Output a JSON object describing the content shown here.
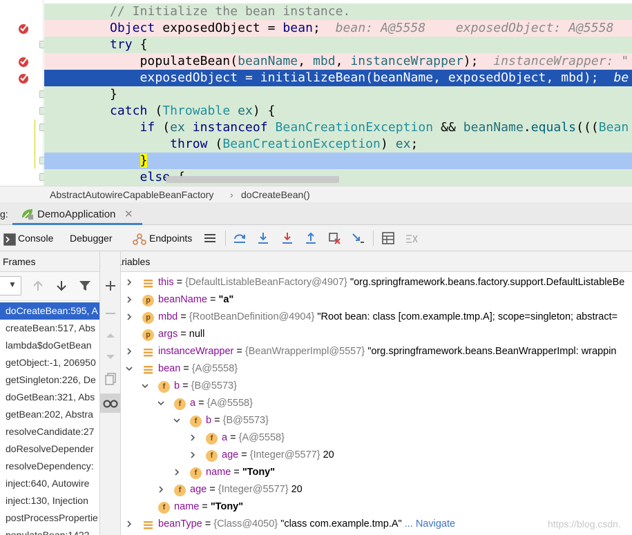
{
  "editor": {
    "lines": [
      {
        "segments": [
          {
            "t": "// Initialize the bean instance.",
            "c": "cmt"
          }
        ],
        "bg": "#d7ead6",
        "breakpoint": false,
        "fold": false
      },
      {
        "segments": [
          {
            "t": "Object ",
            "c": "kw"
          },
          {
            "t": "exposedObject = ",
            "c": "plain"
          },
          {
            "t": "bean",
            "c": "kwb"
          },
          {
            "t": ";  ",
            "c": "plain"
          },
          {
            "t": "bean: A@5558    exposedObject: A@5558",
            "c": "hint"
          }
        ],
        "bg": "#fbe3e3",
        "breakpoint": true,
        "fold": false
      },
      {
        "segments": [
          {
            "t": "try ",
            "c": "kw"
          },
          {
            "t": "{",
            "c": "plain"
          }
        ],
        "bg": "#d7ead6",
        "breakpoint": false,
        "fold": true
      },
      {
        "segments": [
          {
            "t": "    populateBean(",
            "c": "plain"
          },
          {
            "t": "beanName",
            "c": "param"
          },
          {
            "t": ", ",
            "c": "plain"
          },
          {
            "t": "mbd",
            "c": "param"
          },
          {
            "t": ", ",
            "c": "plain"
          },
          {
            "t": "instanceWrapper",
            "c": "param"
          },
          {
            "t": ");  ",
            "c": "plain"
          },
          {
            "t": "instanceWrapper: \"",
            "c": "hint"
          }
        ],
        "bg": "#fbe3e3",
        "breakpoint": true,
        "fold": false
      },
      {
        "segments": [
          {
            "t": "    exposedObject = initializeBean(beanName, exposedObject, mbd);  ",
            "c": "plain"
          },
          {
            "t": "be",
            "c": "hint"
          }
        ],
        "bg": "#2155b3",
        "breakpoint": true,
        "fold": false,
        "selected": true
      },
      {
        "segments": [
          {
            "t": "}",
            "c": "plain"
          }
        ],
        "bg": "#d7ead6",
        "breakpoint": false,
        "fold": true
      },
      {
        "segments": [
          {
            "t": "catch ",
            "c": "kw"
          },
          {
            "t": "(",
            "c": "plain"
          },
          {
            "t": "Throwable ",
            "c": "cls"
          },
          {
            "t": "ex",
            "c": "param"
          },
          {
            "t": ") {",
            "c": "plain"
          }
        ],
        "bg": "#d7ead6",
        "breakpoint": false,
        "fold": true
      },
      {
        "segments": [
          {
            "t": "    if ",
            "c": "kw"
          },
          {
            "t": "(",
            "c": "plain"
          },
          {
            "t": "ex ",
            "c": "param"
          },
          {
            "t": "instanceof ",
            "c": "kw"
          },
          {
            "t": "BeanCreationException ",
            "c": "cls"
          },
          {
            "t": "&& ",
            "c": "plain"
          },
          {
            "t": "beanName",
            "c": "param"
          },
          {
            "t": ".",
            "c": "plain"
          },
          {
            "t": "equals",
            "c": "meth"
          },
          {
            "t": "(((",
            "c": "plain"
          },
          {
            "t": "Bean",
            "c": "cls"
          }
        ],
        "bg": "#d7ead6",
        "breakpoint": false,
        "fold": true
      },
      {
        "segments": [
          {
            "t": "        throw ",
            "c": "kw"
          },
          {
            "t": "(",
            "c": "plain"
          },
          {
            "t": "BeanCreationException",
            "c": "cls"
          },
          {
            "t": ") ",
            "c": "plain"
          },
          {
            "t": "ex",
            "c": "param"
          },
          {
            "t": ";",
            "c": "plain"
          }
        ],
        "bg": "#d7ead6",
        "breakpoint": false,
        "fold": false
      },
      {
        "segments": [
          {
            "t": "    }",
            "c": "brace"
          }
        ],
        "bg": "#a8c6f4",
        "breakpoint": false,
        "fold": true
      },
      {
        "segments": [
          {
            "t": "    else ",
            "c": "kw"
          },
          {
            "t": "{",
            "c": "plain"
          }
        ],
        "bg": "#d7ead6",
        "breakpoint": false,
        "fold": true
      }
    ]
  },
  "breadcrumb": {
    "class_name": "AbstractAutowireCapableBeanFactory",
    "separator": "›",
    "method": "doCreateBean()"
  },
  "debug": {
    "title_label": "g:",
    "run_tab": "DemoApplication",
    "tabs": {
      "console": "Console",
      "debugger": "Debugger",
      "endpoints": "Endpoints"
    }
  },
  "frames": {
    "header": "Frames",
    "items": [
      "doCreateBean:595, A",
      "createBean:517, Abs",
      "lambda$doGetBean",
      "getObject:-1, 206950",
      "getSingleton:226, De",
      "doGetBean:321, Abs",
      "getBean:202, Abstra",
      "resolveCandidate:27",
      "doResolveDepender",
      "resolveDependency:",
      "inject:640, Autowire",
      "inject:130, Injection",
      "postProcessPropertie",
      "populateBean:1422"
    ],
    "selected_index": 0
  },
  "variables": {
    "header": "Variables",
    "rows": [
      {
        "depth": 0,
        "arrow": "right",
        "icon": "list",
        "name": "this",
        "eq": " = ",
        "ref": "{DefaultListableBeanFactory@4907} ",
        "value": "\"org.springframework.beans.factory.support.DefaultListableBe",
        "value_bold": false,
        "nav": ""
      },
      {
        "depth": 0,
        "arrow": "right",
        "icon": "p",
        "name": "beanName",
        "eq": " = ",
        "ref": "",
        "value": "\"a\"",
        "value_bold": true,
        "nav": ""
      },
      {
        "depth": 0,
        "arrow": "right",
        "icon": "p",
        "name": "mbd",
        "eq": " = ",
        "ref": "{RootBeanDefinition@4904} ",
        "value": "\"Root bean: class [com.example.tmp.A]; scope=singleton; abstract=",
        "value_bold": false,
        "nav": ""
      },
      {
        "depth": 0,
        "arrow": "none",
        "icon": "p",
        "name": "args",
        "eq": " = ",
        "ref": "",
        "value": "null",
        "value_bold": false,
        "nav": ""
      },
      {
        "depth": 0,
        "arrow": "right",
        "icon": "list",
        "name": "instanceWrapper",
        "eq": " = ",
        "ref": "{BeanWrapperImpl@5557} ",
        "value": "\"org.springframework.beans.BeanWrapperImpl: wrappin",
        "value_bold": false,
        "nav": ""
      },
      {
        "depth": 0,
        "arrow": "down",
        "icon": "list",
        "name": "bean",
        "eq": " = ",
        "ref": "{A@5558}",
        "value": "",
        "value_bold": false,
        "nav": ""
      },
      {
        "depth": 1,
        "arrow": "down",
        "icon": "f",
        "name": "b",
        "eq": " = ",
        "ref": "{B@5573}",
        "value": "",
        "value_bold": false,
        "nav": ""
      },
      {
        "depth": 2,
        "arrow": "down",
        "icon": "f",
        "name": "a",
        "eq": " = ",
        "ref": "{A@5558}",
        "value": "",
        "value_bold": false,
        "nav": ""
      },
      {
        "depth": 3,
        "arrow": "down",
        "icon": "f",
        "name": "b",
        "eq": " = ",
        "ref": "{B@5573}",
        "value": "",
        "value_bold": false,
        "nav": ""
      },
      {
        "depth": 4,
        "arrow": "right",
        "icon": "f",
        "name": "a",
        "eq": " = ",
        "ref": "{A@5558}",
        "value": "",
        "value_bold": false,
        "nav": ""
      },
      {
        "depth": 4,
        "arrow": "right",
        "icon": "f",
        "name": "age",
        "eq": " = ",
        "ref": "{Integer@5577} ",
        "value": "20",
        "value_bold": false,
        "nav": ""
      },
      {
        "depth": 3,
        "arrow": "right",
        "icon": "f",
        "name": "name",
        "eq": " = ",
        "ref": "",
        "value": "\"Tony\"",
        "value_bold": true,
        "nav": ""
      },
      {
        "depth": 2,
        "arrow": "right",
        "icon": "f",
        "name": "age",
        "eq": " = ",
        "ref": "{Integer@5577} ",
        "value": "20",
        "value_bold": false,
        "nav": ""
      },
      {
        "depth": 1,
        "arrow": "none",
        "icon": "f",
        "name": "name",
        "eq": " = ",
        "ref": "",
        "value": "\"Tony\"",
        "value_bold": true,
        "nav": ""
      },
      {
        "depth": 0,
        "arrow": "right",
        "icon": "list",
        "name": "beanType",
        "eq": " = ",
        "ref": "{Class@4050} ",
        "value": "\"class com.example.tmp.A\"",
        "value_bold": false,
        "nav": " ... Navigate"
      }
    ]
  },
  "watermark": "https://blog.csdn.",
  "colors": {
    "selection": "#2f65ca",
    "breakpoint": "#d93f3f",
    "accent_tab": "#4083c9"
  }
}
